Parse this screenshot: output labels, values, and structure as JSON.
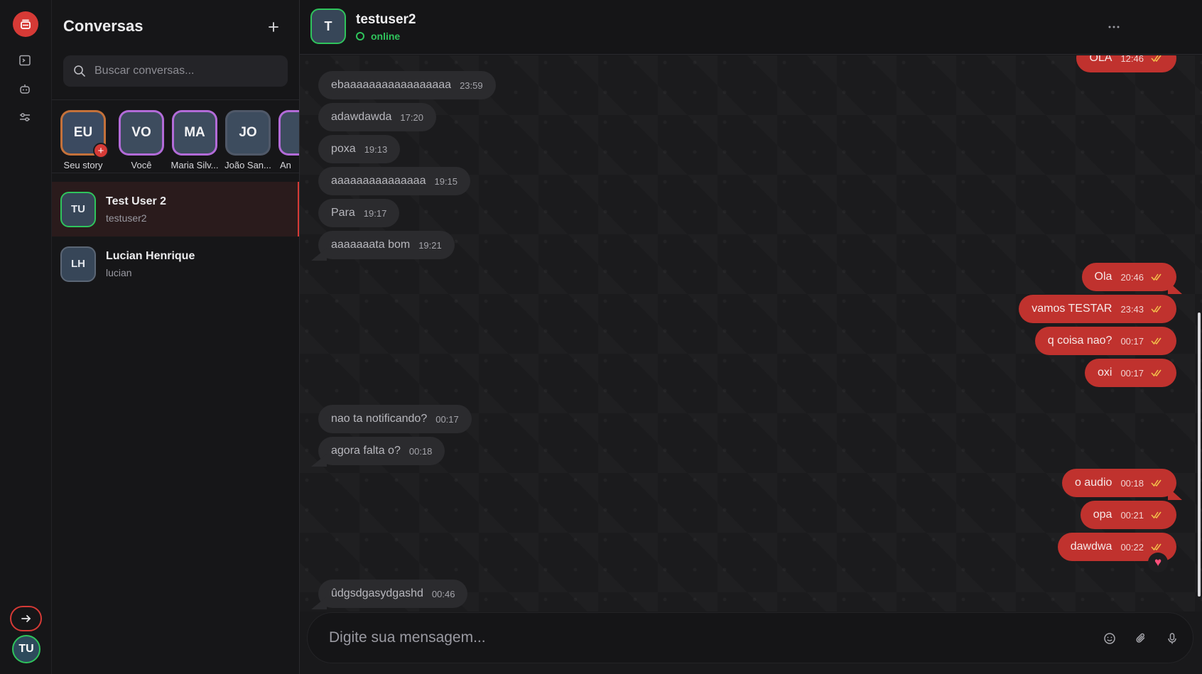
{
  "sidebar": {
    "title": "Conversas",
    "search_placeholder": "Buscar conversas...",
    "stories": [
      {
        "initials": "EU",
        "label": "Seu story",
        "ring": "#c4713a"
      },
      {
        "initials": "VO",
        "label": "Você",
        "ring": "#b26bd8"
      },
      {
        "initials": "MA",
        "label": "Maria Silv...",
        "ring": "#b26bd8"
      },
      {
        "initials": "JO",
        "label": "João San...",
        "ring": "#4f5868"
      },
      {
        "initials": "",
        "label": "An",
        "ring": "#b26bd8"
      }
    ],
    "conversations": [
      {
        "initials": "TU",
        "name": "Test User 2",
        "username": "testuser2"
      },
      {
        "initials": "LH",
        "name": "Lucian Henrique",
        "username": "lucian"
      }
    ]
  },
  "rail": {
    "user_initials": "TU"
  },
  "chat": {
    "contact_initial": "T",
    "contact_name": "testuser2",
    "status": "online",
    "messages": [
      {
        "dir": "out",
        "text": "OLA",
        "time": "12:46"
      },
      {
        "dir": "in",
        "text": "ebaaaaaaaaaaaaaaaaa",
        "time": "23:59"
      },
      {
        "dir": "in",
        "text": "adawdawda",
        "time": "17:20"
      },
      {
        "dir": "in",
        "text": "poxa",
        "time": "19:13"
      },
      {
        "dir": "in",
        "text": "aaaaaaaaaaaaaaa",
        "time": "19:15"
      },
      {
        "dir": "in",
        "text": "Para",
        "time": "19:17"
      },
      {
        "dir": "in",
        "text": "aaaaaaata bom",
        "time": "19:21"
      },
      {
        "dir": "out",
        "text": "Ola",
        "time": "20:46"
      },
      {
        "dir": "out",
        "text": "vamos TESTAR",
        "time": "23:43"
      },
      {
        "dir": "out",
        "text": "q coisa nao?",
        "time": "00:17"
      },
      {
        "dir": "out",
        "text": "oxi",
        "time": "00:17"
      },
      {
        "dir": "in",
        "text": "nao ta notificando?",
        "time": "00:17"
      },
      {
        "dir": "in",
        "text": "agora falta o?",
        "time": "00:18"
      },
      {
        "dir": "out",
        "text": "o audio",
        "time": "00:18"
      },
      {
        "dir": "out",
        "text": "opa",
        "time": "00:21"
      },
      {
        "dir": "out",
        "text": "dawdwa",
        "time": "00:22",
        "reaction": "heart"
      },
      {
        "dir": "in",
        "text": "ûdgsdgasydgashd",
        "time": "00:46"
      }
    ],
    "composer_placeholder": "Digite sua mensagem..."
  },
  "colors": {
    "accent": "#d63a36",
    "online": "#2fc45c",
    "bubble_in": "#2b2b2e",
    "bubble_out": "#c0322e"
  },
  "icons": [
    "stories-icon",
    "terminal-icon",
    "bot-icon",
    "settings-sliders-icon",
    "logout-arrow-icon",
    "plus-icon",
    "search-icon",
    "more-icon",
    "double-check-icon",
    "heart-icon",
    "emoji-icon",
    "attach-icon",
    "mic-icon"
  ]
}
